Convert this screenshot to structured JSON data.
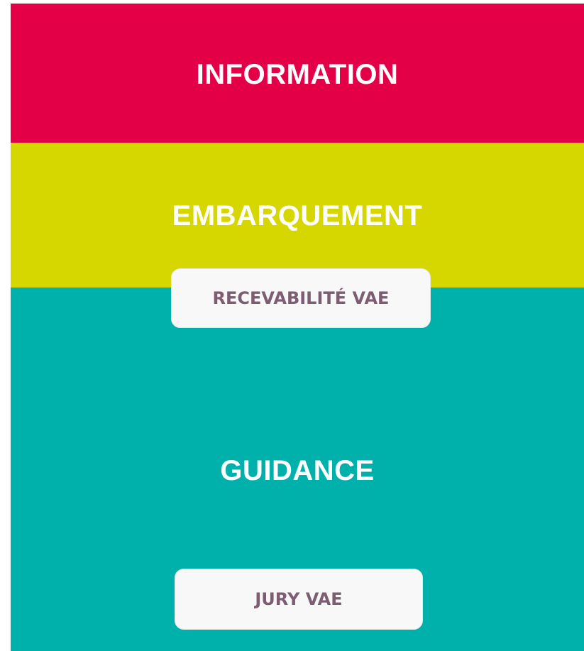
{
  "stages": [
    {
      "label": "INFORMATION",
      "color": "#e30046"
    },
    {
      "label": "EMBARQUEMENT",
      "color": "#d6d700"
    },
    {
      "label": "GUIDANCE",
      "color": "#00b0aa"
    }
  ],
  "milestones": [
    {
      "label": "RECEVABILITÉ VAE"
    },
    {
      "label": "JURY VAE"
    }
  ],
  "colors": {
    "milestone_background": "#f8f8f9",
    "milestone_text": "#7d5d72",
    "stage_text": "#ffffff"
  }
}
